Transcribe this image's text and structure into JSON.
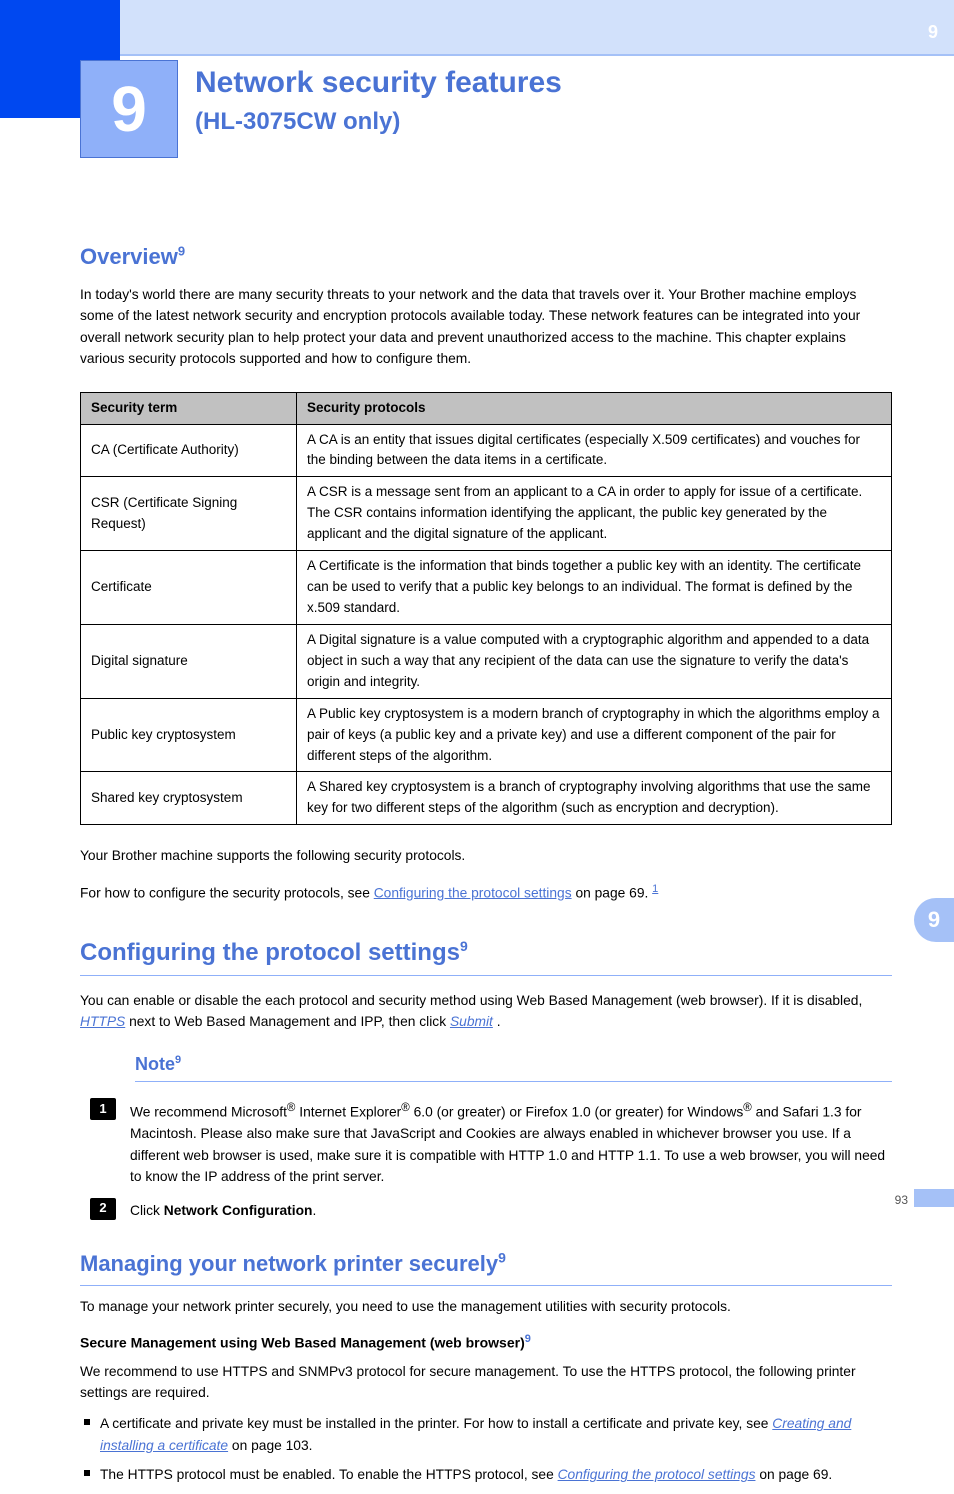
{
  "header": {
    "banner_number": "9",
    "square_number": "9",
    "title": "Network security features",
    "subtitle": "(HL-3075CW only)"
  },
  "overview": {
    "heading": "Overview",
    "sup": "9",
    "intro": "In today's world there are many security threats to your network and the data that travels over it. Your Brother machine employs some of the latest network security and encryption protocols available today. These network features can be integrated into your overall network security plan to help protect your data and prevent unauthorized access to the machine. This chapter explains various security protocols supported and how to configure them."
  },
  "table": {
    "col1": "Security term",
    "col2": "Security protocols",
    "rows": [
      {
        "term": "CA (Certificate Authority)",
        "def": "A CA is an entity that issues digital certificates (especially X.509 certificates) and vouches for the binding between the data items in a certificate."
      },
      {
        "term": "CSR (Certificate Signing Request)",
        "def": "A CSR is a message sent from an applicant to a CA in order to apply for issue of a certificate. The CSR contains information identifying the applicant, the public key generated by the applicant and the digital signature of the applicant."
      },
      {
        "term": "Certificate",
        "def": "A Certificate is the information that binds together a public key with an identity. The certificate can be used to verify that a public key belongs to an individual. The format is defined by the x.509 standard."
      },
      {
        "term": "Digital signature",
        "def": "A Digital signature is a value computed with a cryptographic algorithm and appended to a data object in such a way that any recipient of the data can use the signature to verify the data's origin and integrity."
      },
      {
        "term": "Public key cryptosystem",
        "def": "A Public key cryptosystem is a modern branch of cryptography in which the algorithms employ a pair of keys (a public key and a private key) and use a different component of the pair for different steps of the algorithm."
      },
      {
        "term": "Shared key cryptosystem",
        "def": "A Shared key cryptosystem is a branch of cryptography involving algorithms that use the same key for two different steps of the algorithm (such as encryption and decryption)."
      }
    ]
  },
  "after_table": {
    "p1": "Your Brother machine supports the following security protocols.",
    "p2_prefix": "For how to configure the security protocols, see ",
    "p2_link": "Configuring the protocol settings",
    "p2_after": " on page 69.",
    "sup": "1"
  },
  "conf_section": {
    "heading": "Configuring the protocol settings",
    "sup": "9",
    "para_prefix": "You can enable or disable the each protocol and security method using Web Based Management (web browser). If it is disabled, ",
    "para_em": "HTTPS",
    "para_middle": " next to Web Based Management and IPP, then click ",
    "para_em2": "Submit",
    "para_end": "."
  },
  "sub_section": {
    "heading": "Note",
    "sup": "9",
    "step1_prefix": "We recommend Microsoft",
    "step1_sup": "®",
    "step1_middle": " Internet Explorer",
    "step1_sup2": "®",
    "step1_after": " 6.0 (or greater) or Firefox 1.0 (or greater) for Windows",
    "step1_sup3": "®",
    "step1_after2": " and Safari 1.3 for Macintosh. Please also make sure that JavaScript and Cookies are always enabled in whichever browser you use. If a different web browser is used, make sure it is compatible with HTTP 1.0 and HTTP 1.1. To use a web browser, you will need to know the IP address of the print server.",
    "step2_prefix": "Click ",
    "step2_bold": "Network Configuration",
    "step2_after": "."
  },
  "secure_section": {
    "heading": "Managing your network printer securely",
    "sup": "9",
    "intro": "To manage your network printer securely, you need to use the management utilities with security protocols.",
    "sub_heading": "Secure Management using Web Based Management (web browser)",
    "sub_sup": "9",
    "p1_prefix": "We recommend to use HTTPS and SNMPv3 protocol for secure management. To use the HTTPS protocol, the following printer settings are required.",
    "b1_prefix": "A certificate and private key must be installed in the printer. For how to install a certificate and private key, see ",
    "b1_link": "Creating and installing a certificate",
    "b1_after": " on page 103.",
    "b2_prefix": "The HTTPS protocol must be enabled. To enable the HTTPS protocol, see ",
    "b2_link": "Configuring the protocol settings",
    "b2_after": " on page 69."
  },
  "side_tab": "9",
  "page_number": "93"
}
